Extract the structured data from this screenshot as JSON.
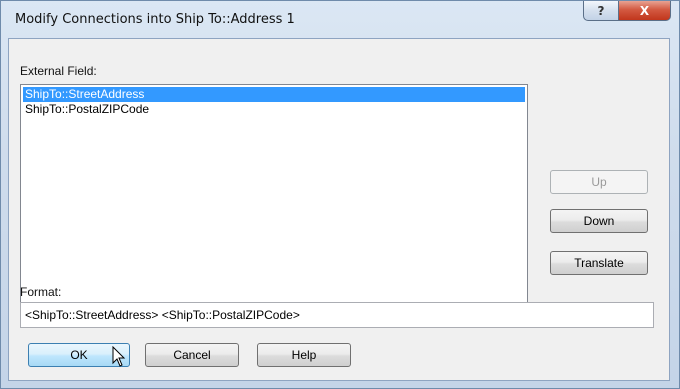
{
  "window": {
    "title": "Modify Connections into Ship To::Address 1",
    "help_label": "?",
    "close_label": "X"
  },
  "external_field": {
    "label": "External Field:",
    "items": [
      {
        "label": "ShipTo::StreetAddress",
        "selected": true
      },
      {
        "label": "ShipTo::PostalZIPCode",
        "selected": false
      }
    ]
  },
  "side_buttons": {
    "up": "Up",
    "down": "Down",
    "translate": "Translate"
  },
  "format": {
    "label": "Format:",
    "value": "<ShipTo::StreetAddress> <ShipTo::PostalZIPCode>"
  },
  "footer_buttons": {
    "ok": "OK",
    "cancel": "Cancel",
    "help": "Help"
  },
  "icons": {
    "cursor": "arrow-cursor-icon"
  }
}
